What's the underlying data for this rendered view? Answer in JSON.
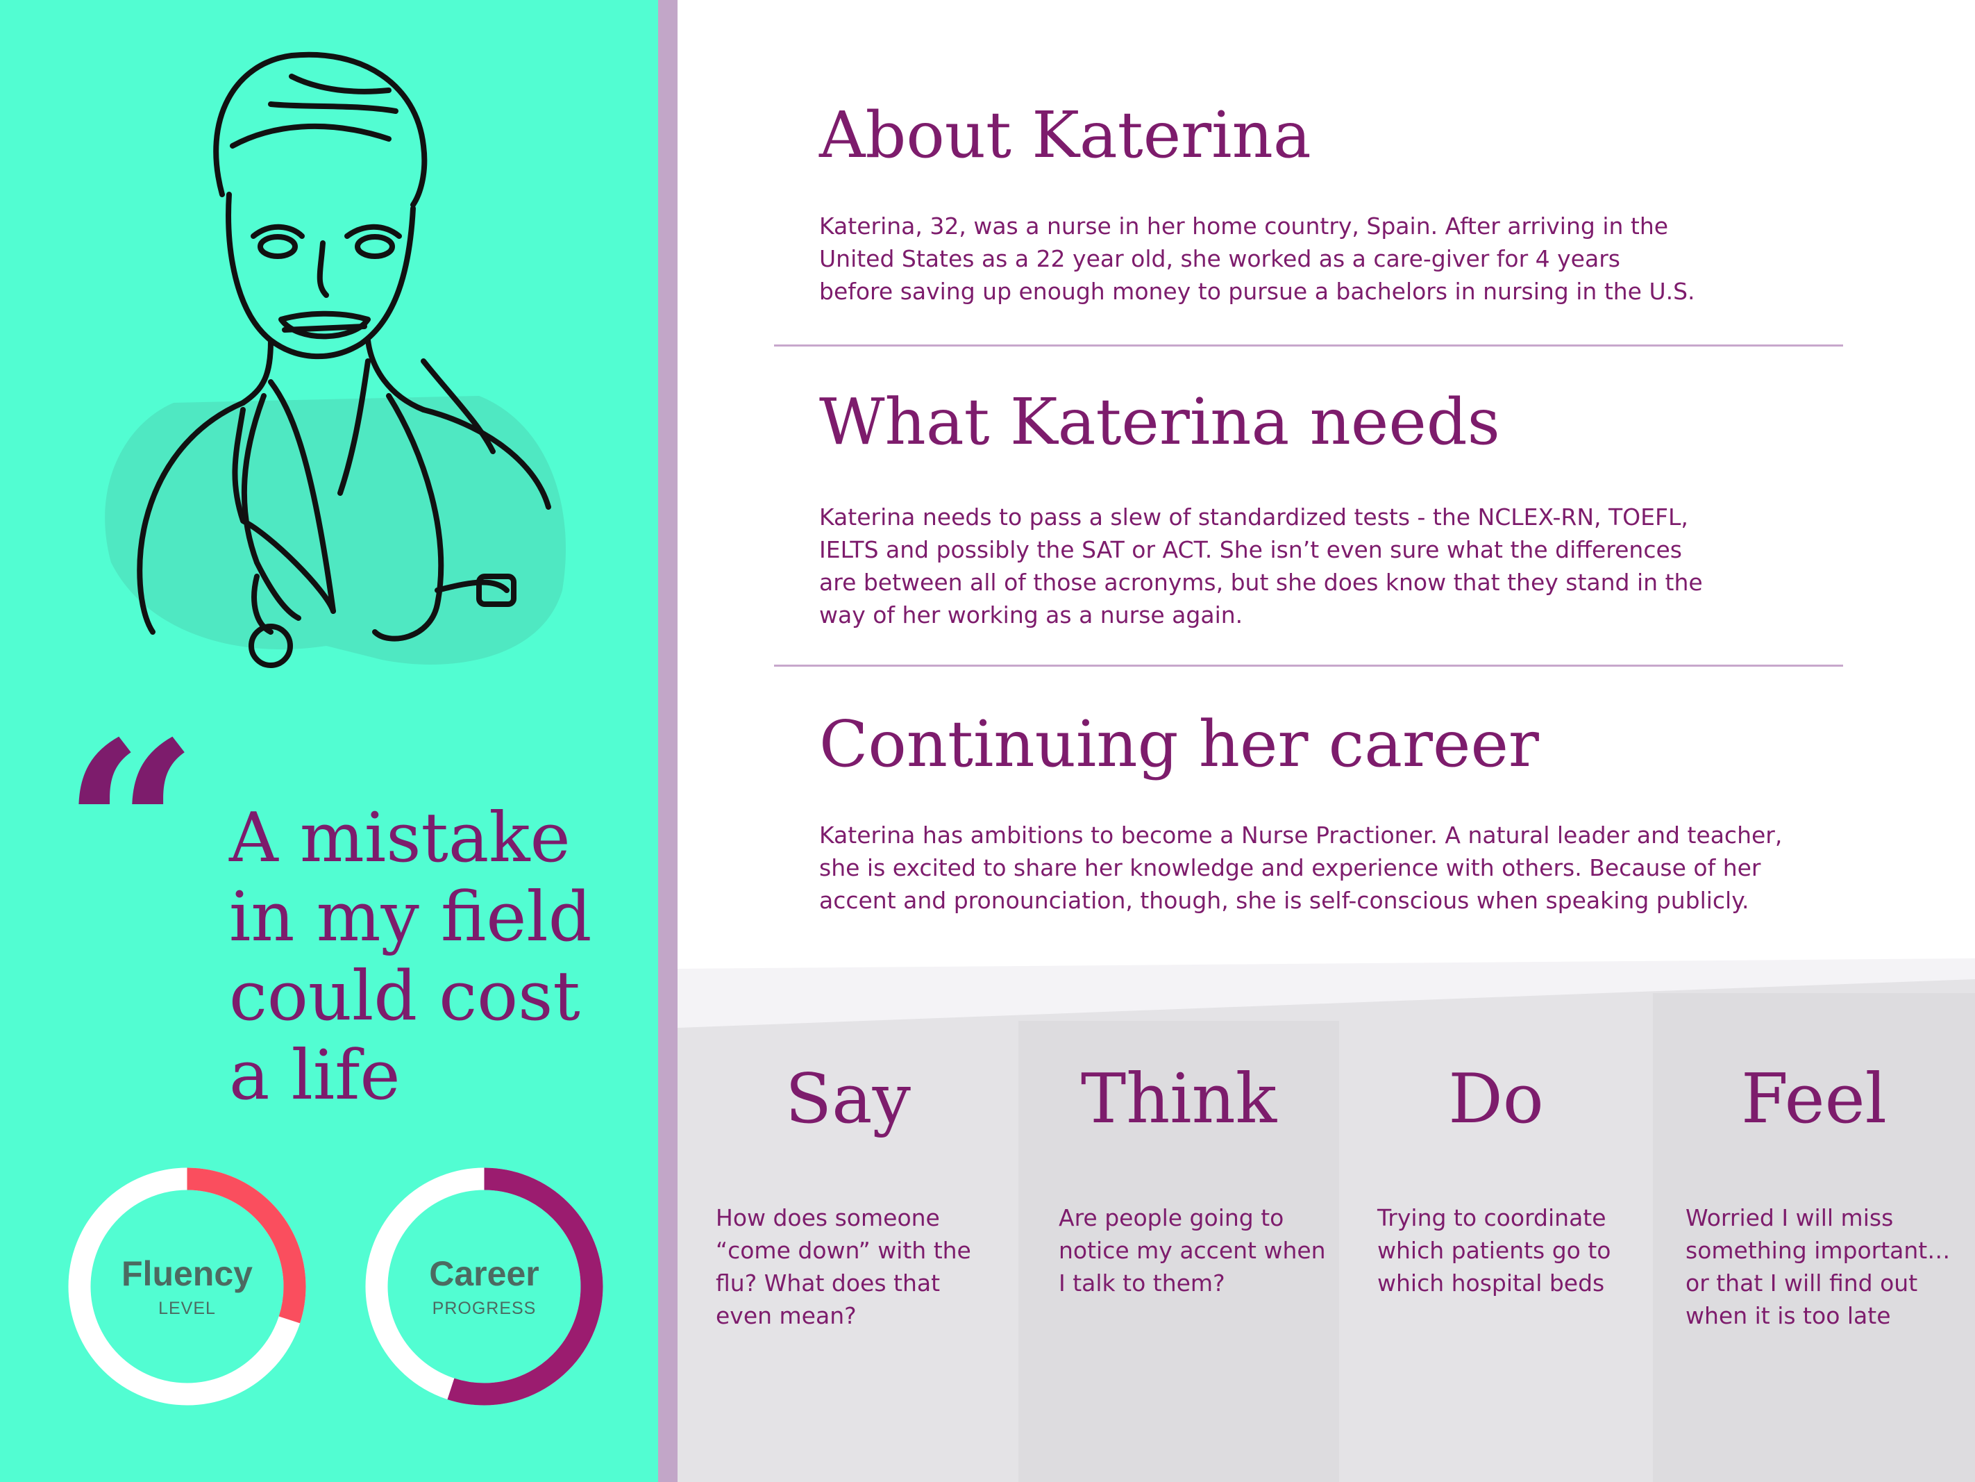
{
  "quote": {
    "mark": "“",
    "lines": [
      "A mistake",
      "in my field",
      "could cost",
      "a life"
    ]
  },
  "gauges": [
    {
      "title": "Fluency",
      "subtitle": "LEVEL",
      "fraction": 0.3,
      "color": "#FA4E5E"
    },
    {
      "title": "Career",
      "subtitle": "PROGRESS",
      "fraction": 0.55,
      "color": "#9B1C6F"
    }
  ],
  "about": {
    "heading": "About Katerina",
    "lines": [
      "Katerina, 32, was a nurse in her home country, Spain. After arriving in the",
      "United States as a 22 year old, she worked as a care-giver for 4 years",
      "before saving up enough money to pursue a bachelors in nursing in the U.S."
    ]
  },
  "needs": {
    "heading": "What Katerina needs",
    "lines": [
      "Katerina needs to pass a slew of standardized tests - the NCLEX-RN, TOEFL,",
      "IELTS and possibly the SAT or ACT. She isn’t even sure what the differences",
      "are between all of those acronyms, but she does know that they stand in the",
      "way of her working as a nurse again."
    ]
  },
  "career": {
    "heading": "Continuing her career",
    "lines": [
      "Katerina has ambitions to become a Nurse Practioner. A natural leader and teacher,",
      "she is excited to share her knowledge and experience with others. Because of her",
      "accent and pronounciation, though, she is self-conscious when speaking publicly."
    ]
  },
  "columns": [
    {
      "title": "Say",
      "lines": [
        "How does someone",
        "“come down” with the",
        "flu? What does that",
        "even mean?"
      ]
    },
    {
      "title": "Think",
      "lines": [
        "Are people going to",
        "notice my accent when",
        "I talk to them?"
      ]
    },
    {
      "title": "Do",
      "lines": [
        "Trying to coordinate",
        "which patients go to",
        "which hospital beds"
      ]
    },
    {
      "title": "Feel",
      "lines": [
        "Worried I will miss",
        "something important…",
        "or that I will find out",
        "when it is too late"
      ]
    }
  ],
  "colors": {
    "mint": "#52FDD2",
    "purple": "#7D1C6C",
    "lilac": "#C2A6C8",
    "gray_light": "#E4E3E6",
    "gray_dark": "#DDDCDF"
  }
}
